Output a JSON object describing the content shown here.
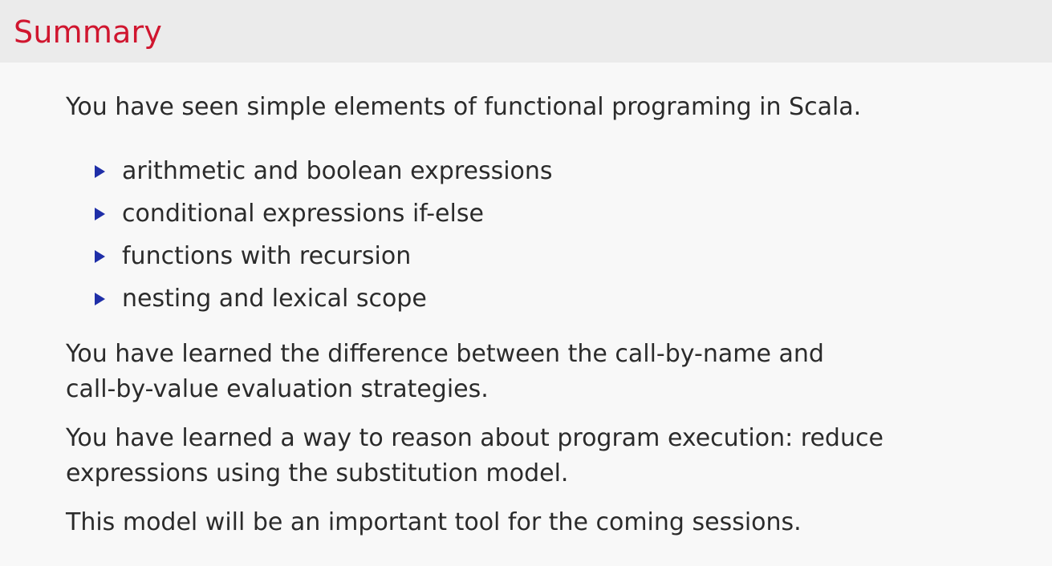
{
  "slide": {
    "title": "Summary",
    "intro": "You have seen simple elements of functional programing in Scala.",
    "bullets": [
      "arithmetic and boolean expressions",
      "conditional expressions if-else",
      "functions with recursion",
      "nesting and lexical scope"
    ],
    "p2_line1": "You have learned the difference between the call-by-name and",
    "p2_line2": "call-by-value evaluation strategies.",
    "p3_line1": "You have learned a way to reason about program execution: reduce",
    "p3_line2": "expressions using the substitution model.",
    "p4": "This model will be an important tool for the coming sessions."
  },
  "colors": {
    "title": "#d0162f",
    "bullet": "#1f2fa8",
    "text": "#2b2b2b",
    "title_bar_bg": "#ebebeb",
    "slide_bg": "#f8f8f8"
  }
}
